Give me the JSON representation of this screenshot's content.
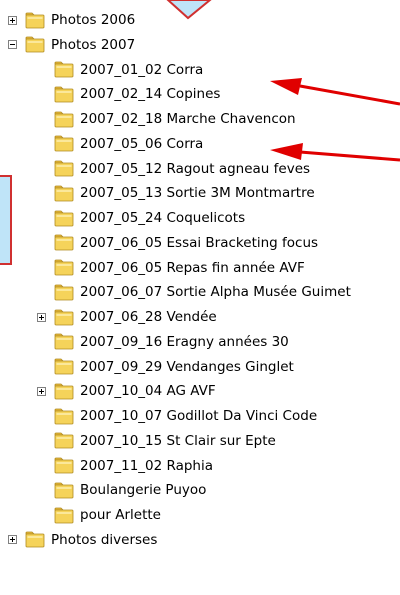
{
  "tree": {
    "items": [
      {
        "label": "Photos 2006",
        "level": 0,
        "toggle": "plus"
      },
      {
        "label": "Photos 2007",
        "level": 0,
        "toggle": "minus"
      },
      {
        "label": "2007_01_02 Corra",
        "level": 1,
        "toggle": "none"
      },
      {
        "label": "2007_02_14 Copines",
        "level": 1,
        "toggle": "none"
      },
      {
        "label": "2007_02_18 Marche Chavencon",
        "level": 1,
        "toggle": "none"
      },
      {
        "label": "2007_05_06 Corra",
        "level": 1,
        "toggle": "none"
      },
      {
        "label": "2007_05_12 Ragout agneau feves",
        "level": 1,
        "toggle": "none"
      },
      {
        "label": "2007_05_13 Sortie 3M Montmartre",
        "level": 1,
        "toggle": "none"
      },
      {
        "label": "2007_05_24 Coquelicots",
        "level": 1,
        "toggle": "none"
      },
      {
        "label": "2007_06_05 Essai Bracketing focus",
        "level": 1,
        "toggle": "none"
      },
      {
        "label": "2007_06_05 Repas fin année AVF",
        "level": 1,
        "toggle": "none"
      },
      {
        "label": "2007_06_07 Sortie Alpha Musée Guimet",
        "level": 1,
        "toggle": "none"
      },
      {
        "label": "2007_06_28 Vendée",
        "level": 1,
        "toggle": "plus"
      },
      {
        "label": "2007_09_16 Eragny années 30",
        "level": 1,
        "toggle": "none"
      },
      {
        "label": "2007_09_29 Vendanges Ginglet",
        "level": 1,
        "toggle": "none"
      },
      {
        "label": "2007_10_04 AG AVF",
        "level": 1,
        "toggle": "plus"
      },
      {
        "label": "2007_10_07 Godillot Da Vinci Code",
        "level": 1,
        "toggle": "none"
      },
      {
        "label": "2007_10_15 St Clair sur Epte",
        "level": 1,
        "toggle": "none"
      },
      {
        "label": "2007_11_02 Raphia",
        "level": 1,
        "toggle": "none"
      },
      {
        "label": "Boulangerie Puyoo",
        "level": 1,
        "toggle": "none"
      },
      {
        "label": "pour Arlette",
        "level": 1,
        "toggle": "none"
      },
      {
        "label": "Photos diverses",
        "level": 0,
        "toggle": "plus"
      }
    ]
  },
  "colors": {
    "folder_fill": "#f5d35a",
    "folder_tab": "#e8b93a",
    "folder_outline": "#b08a20",
    "arrow": "#e00000",
    "panel_blue": "#bfe4f8",
    "panel_border": "#d03030"
  },
  "icons": {
    "folder": "folder-icon",
    "expand": "expand-plus-icon",
    "collapse": "collapse-minus-icon",
    "arrow": "red-arrow-icon"
  }
}
